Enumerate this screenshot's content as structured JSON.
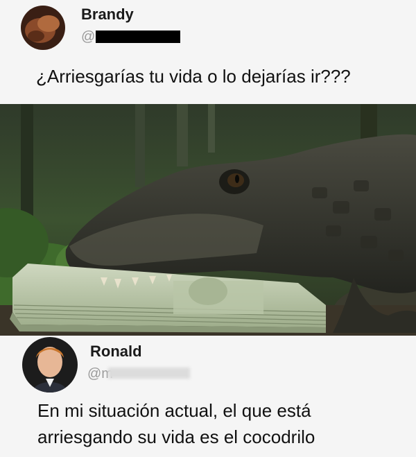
{
  "post1": {
    "name": "Brandy",
    "handle": "@",
    "text": "¿Arriesgarías tu vida o lo dejarías ir???"
  },
  "photo": {
    "icon": "crocodile-biting-money-image"
  },
  "post2": {
    "name": "Ronald",
    "handle": "@m",
    "text_line1": "En mi situación actual, el que está",
    "text_line2": "arriesgando su vida es el cocodrilo"
  }
}
